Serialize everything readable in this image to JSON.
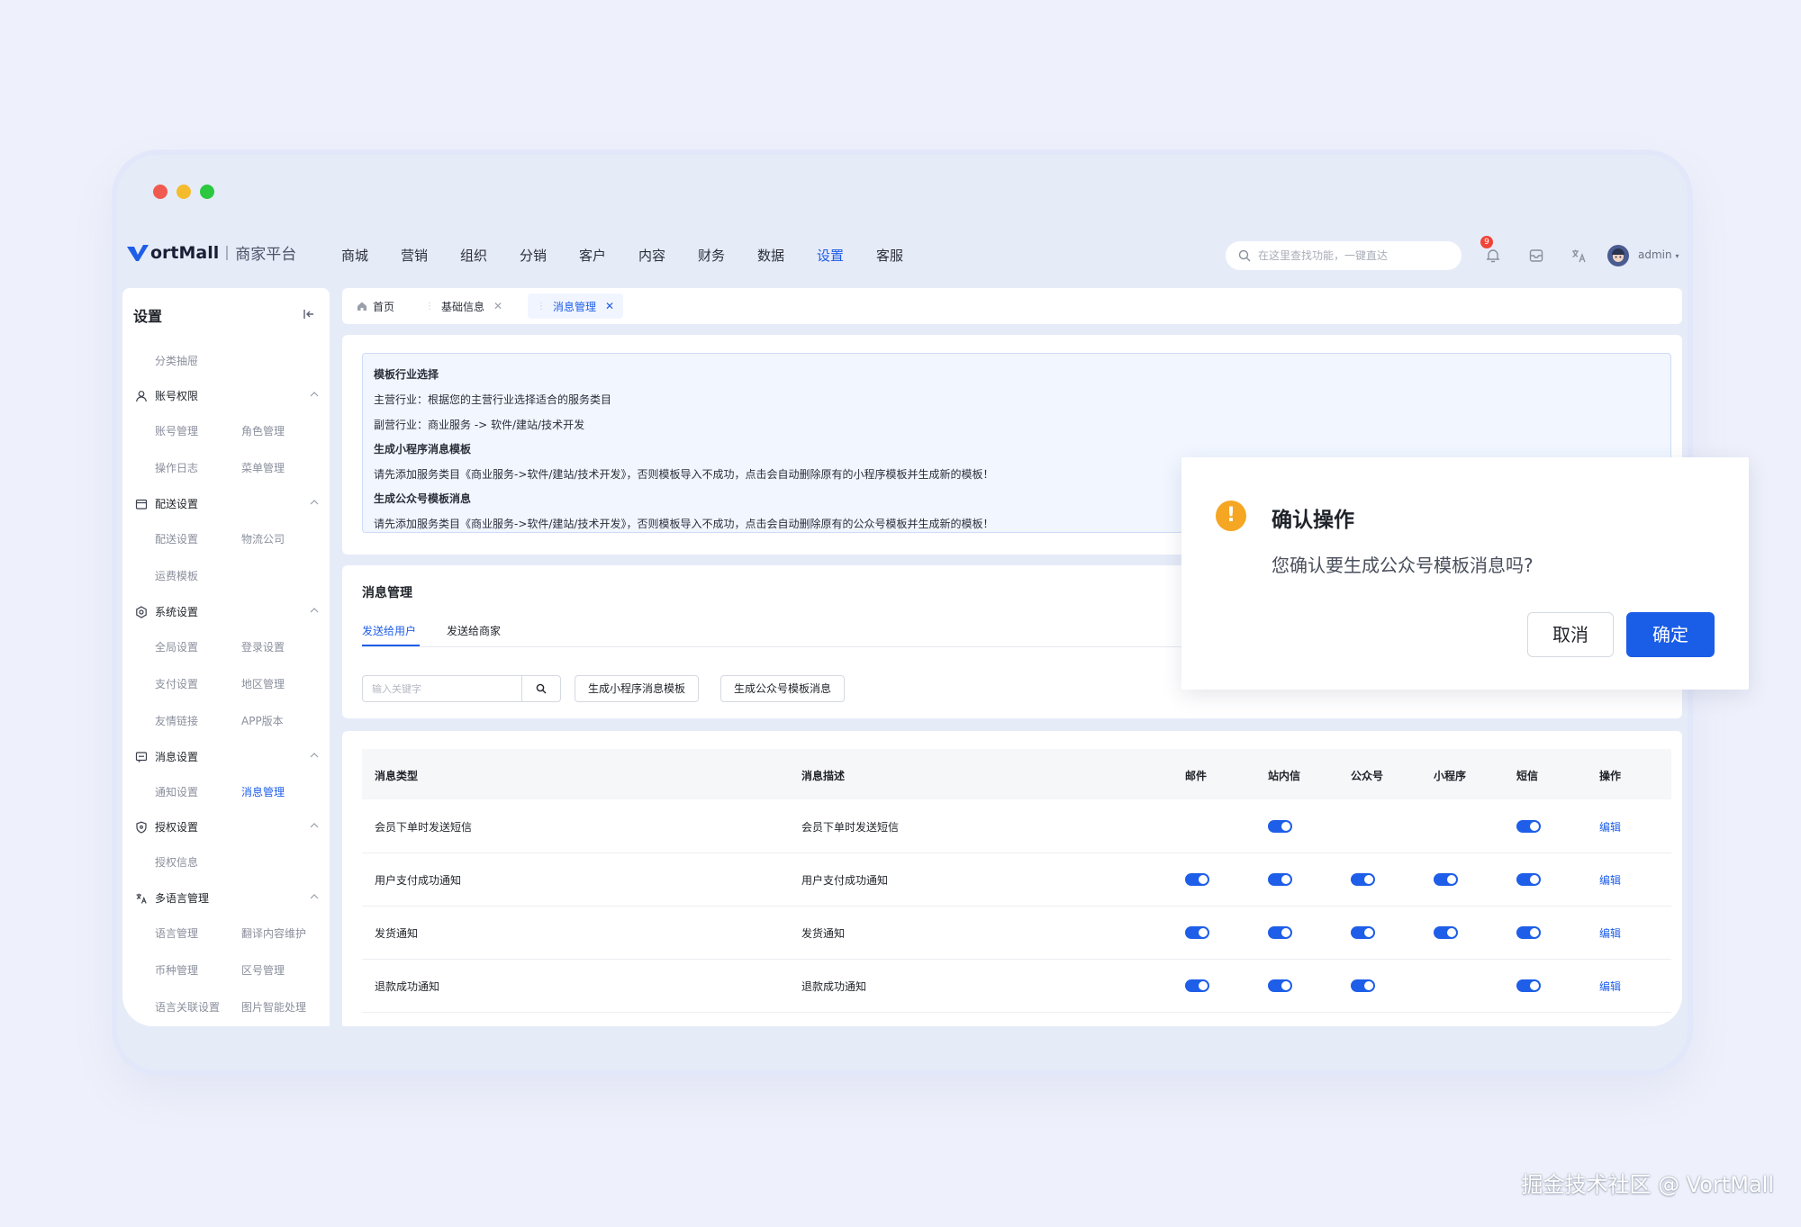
{
  "window": {
    "dot_colors": [
      "#f05a4f",
      "#f4bc2c",
      "#2bc840"
    ]
  },
  "header": {
    "brand_text": "ortMall",
    "brand_sub": "商家平台",
    "nav": [
      "商城",
      "营销",
      "组织",
      "分销",
      "客户",
      "内容",
      "财务",
      "数据",
      "设置",
      "客服"
    ],
    "active_nav": "设置",
    "search_placeholder": "在这里查找功能，一键直达",
    "notification_count": "9",
    "user": "admin"
  },
  "sidebar": {
    "title": "设置",
    "top_item": "分类抽屉",
    "groups": [
      {
        "label": "账号权限",
        "icon": "user-icon",
        "items": [
          "账号管理",
          "角色管理",
          "操作日志",
          "菜单管理"
        ]
      },
      {
        "label": "配送设置",
        "icon": "delivery-icon",
        "items": [
          "配送设置",
          "物流公司",
          "运费模板"
        ]
      },
      {
        "label": "系统设置",
        "icon": "settings-icon",
        "items": [
          "全局设置",
          "登录设置",
          "支付设置",
          "地区管理",
          "友情链接",
          "APP版本"
        ]
      },
      {
        "label": "消息设置",
        "icon": "message-icon",
        "items": [
          "通知设置",
          "消息管理"
        ]
      },
      {
        "label": "授权设置",
        "icon": "shield-icon",
        "items": [
          "授权信息"
        ]
      },
      {
        "label": "多语言管理",
        "icon": "translate-icon",
        "items": [
          "语言管理",
          "翻译内容维护",
          "币种管理",
          "区号管理",
          "语言关联设置",
          "图片智能处理"
        ]
      }
    ],
    "active_item": "消息管理"
  },
  "tabs": [
    {
      "label": "首页"
    },
    {
      "label": "基础信息"
    },
    {
      "label": "消息管理"
    }
  ],
  "notice": [
    "模板行业选择",
    "主营行业：根据您的主营行业选择适合的服务类目",
    "副营行业：商业服务 -> 软件/建站/技术开发",
    "生成小程序消息模板",
    "请先添加服务类目《商业服务->软件/建站/技术开发》，否则模板导入不成功，点击会自动删除原有的小程序模板并生成新的模板！",
    "生成公众号模板消息",
    "请先添加服务类目《商业服务->软件/建站/技术开发》，否则模板导入不成功，点击会自动删除原有的公众号模板并生成新的模板！"
  ],
  "message_mgmt": {
    "title": "消息管理",
    "subtabs": [
      "发送给用户",
      "发送给商家"
    ],
    "keyword_placeholder": "输入关键字",
    "btn_mini": "生成小程序消息模板",
    "btn_official": "生成公众号模板消息"
  },
  "table": {
    "columns": [
      "消息类型",
      "消息描述",
      "邮件",
      "站内信",
      "公众号",
      "小程序",
      "短信",
      "操作"
    ],
    "rows": [
      {
        "type": "会员下单时发送短信",
        "desc": "会员下单时发送短信",
        "email": false,
        "site": true,
        "official": false,
        "mini": false,
        "sms": true,
        "action": "编辑"
      },
      {
        "type": "用户支付成功通知",
        "desc": "用户支付成功通知",
        "email": true,
        "site": true,
        "official": true,
        "mini": true,
        "sms": true,
        "action": "编辑"
      },
      {
        "type": "发货通知",
        "desc": "发货通知",
        "email": true,
        "site": true,
        "official": true,
        "mini": true,
        "sms": true,
        "action": "编辑"
      },
      {
        "type": "退款成功通知",
        "desc": "退款成功通知",
        "email": true,
        "site": true,
        "official": true,
        "mini": false,
        "sms": true,
        "action": "编辑"
      }
    ]
  },
  "dialog": {
    "title": "确认操作",
    "message": "您确认要生成公众号模板消息吗?",
    "cancel": "取消",
    "confirm": "确定"
  },
  "watermark": "掘金技术社区 @ VortMall",
  "colors": {
    "primary": "#1e5ee8",
    "warning": "#f5a623",
    "badge": "#f04438"
  }
}
